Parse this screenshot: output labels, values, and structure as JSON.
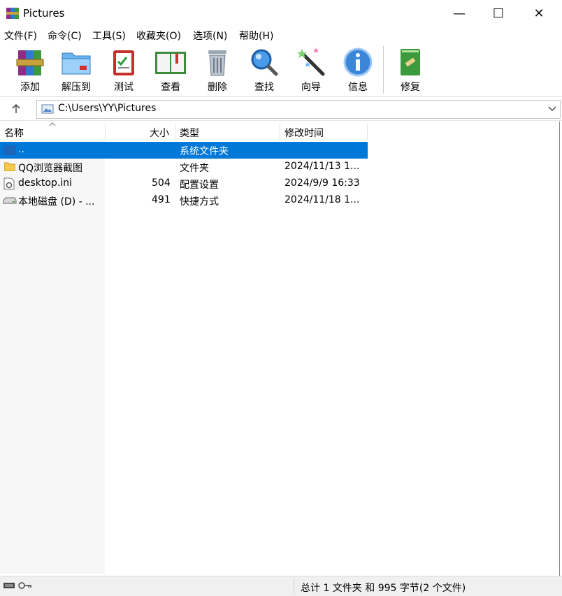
{
  "window": {
    "title": "Pictures",
    "min": "—",
    "max": "☐",
    "close": "✕"
  },
  "menu": [
    "文件(F)",
    "命令(C)",
    "工具(S)",
    "收藏夹(O)",
    "选项(N)",
    "帮助(H)"
  ],
  "toolbar": {
    "add": "添加",
    "extract": "解压到",
    "test": "测试",
    "view": "查看",
    "delete": "删除",
    "find": "查找",
    "wizard": "向导",
    "info": "信息",
    "repair": "修复"
  },
  "address": {
    "path": "C:\\Users\\YY\\Pictures"
  },
  "columns": {
    "name": "名称",
    "size": "大小",
    "type": "类型",
    "modified": "修改时间"
  },
  "rows": [
    {
      "name": "..",
      "size": "",
      "type": "系统文件夹",
      "modified": ""
    },
    {
      "name": "QQ浏览器截图",
      "size": "",
      "type": "文件夹",
      "modified": "2024/11/13 1..."
    },
    {
      "name": "desktop.ini",
      "size": "504",
      "type": "配置设置",
      "modified": "2024/9/9 16:33"
    },
    {
      "name": "本地磁盘 (D) - ...",
      "size": "491",
      "type": "快捷方式",
      "modified": "2024/11/18 1..."
    }
  ],
  "status": {
    "text": "总计 1 文件夹 和 995 字节(2 个文件)"
  },
  "colors": {
    "selection": "#0078d7",
    "folder": "#f2c94c",
    "accent": "#1e88e5"
  }
}
